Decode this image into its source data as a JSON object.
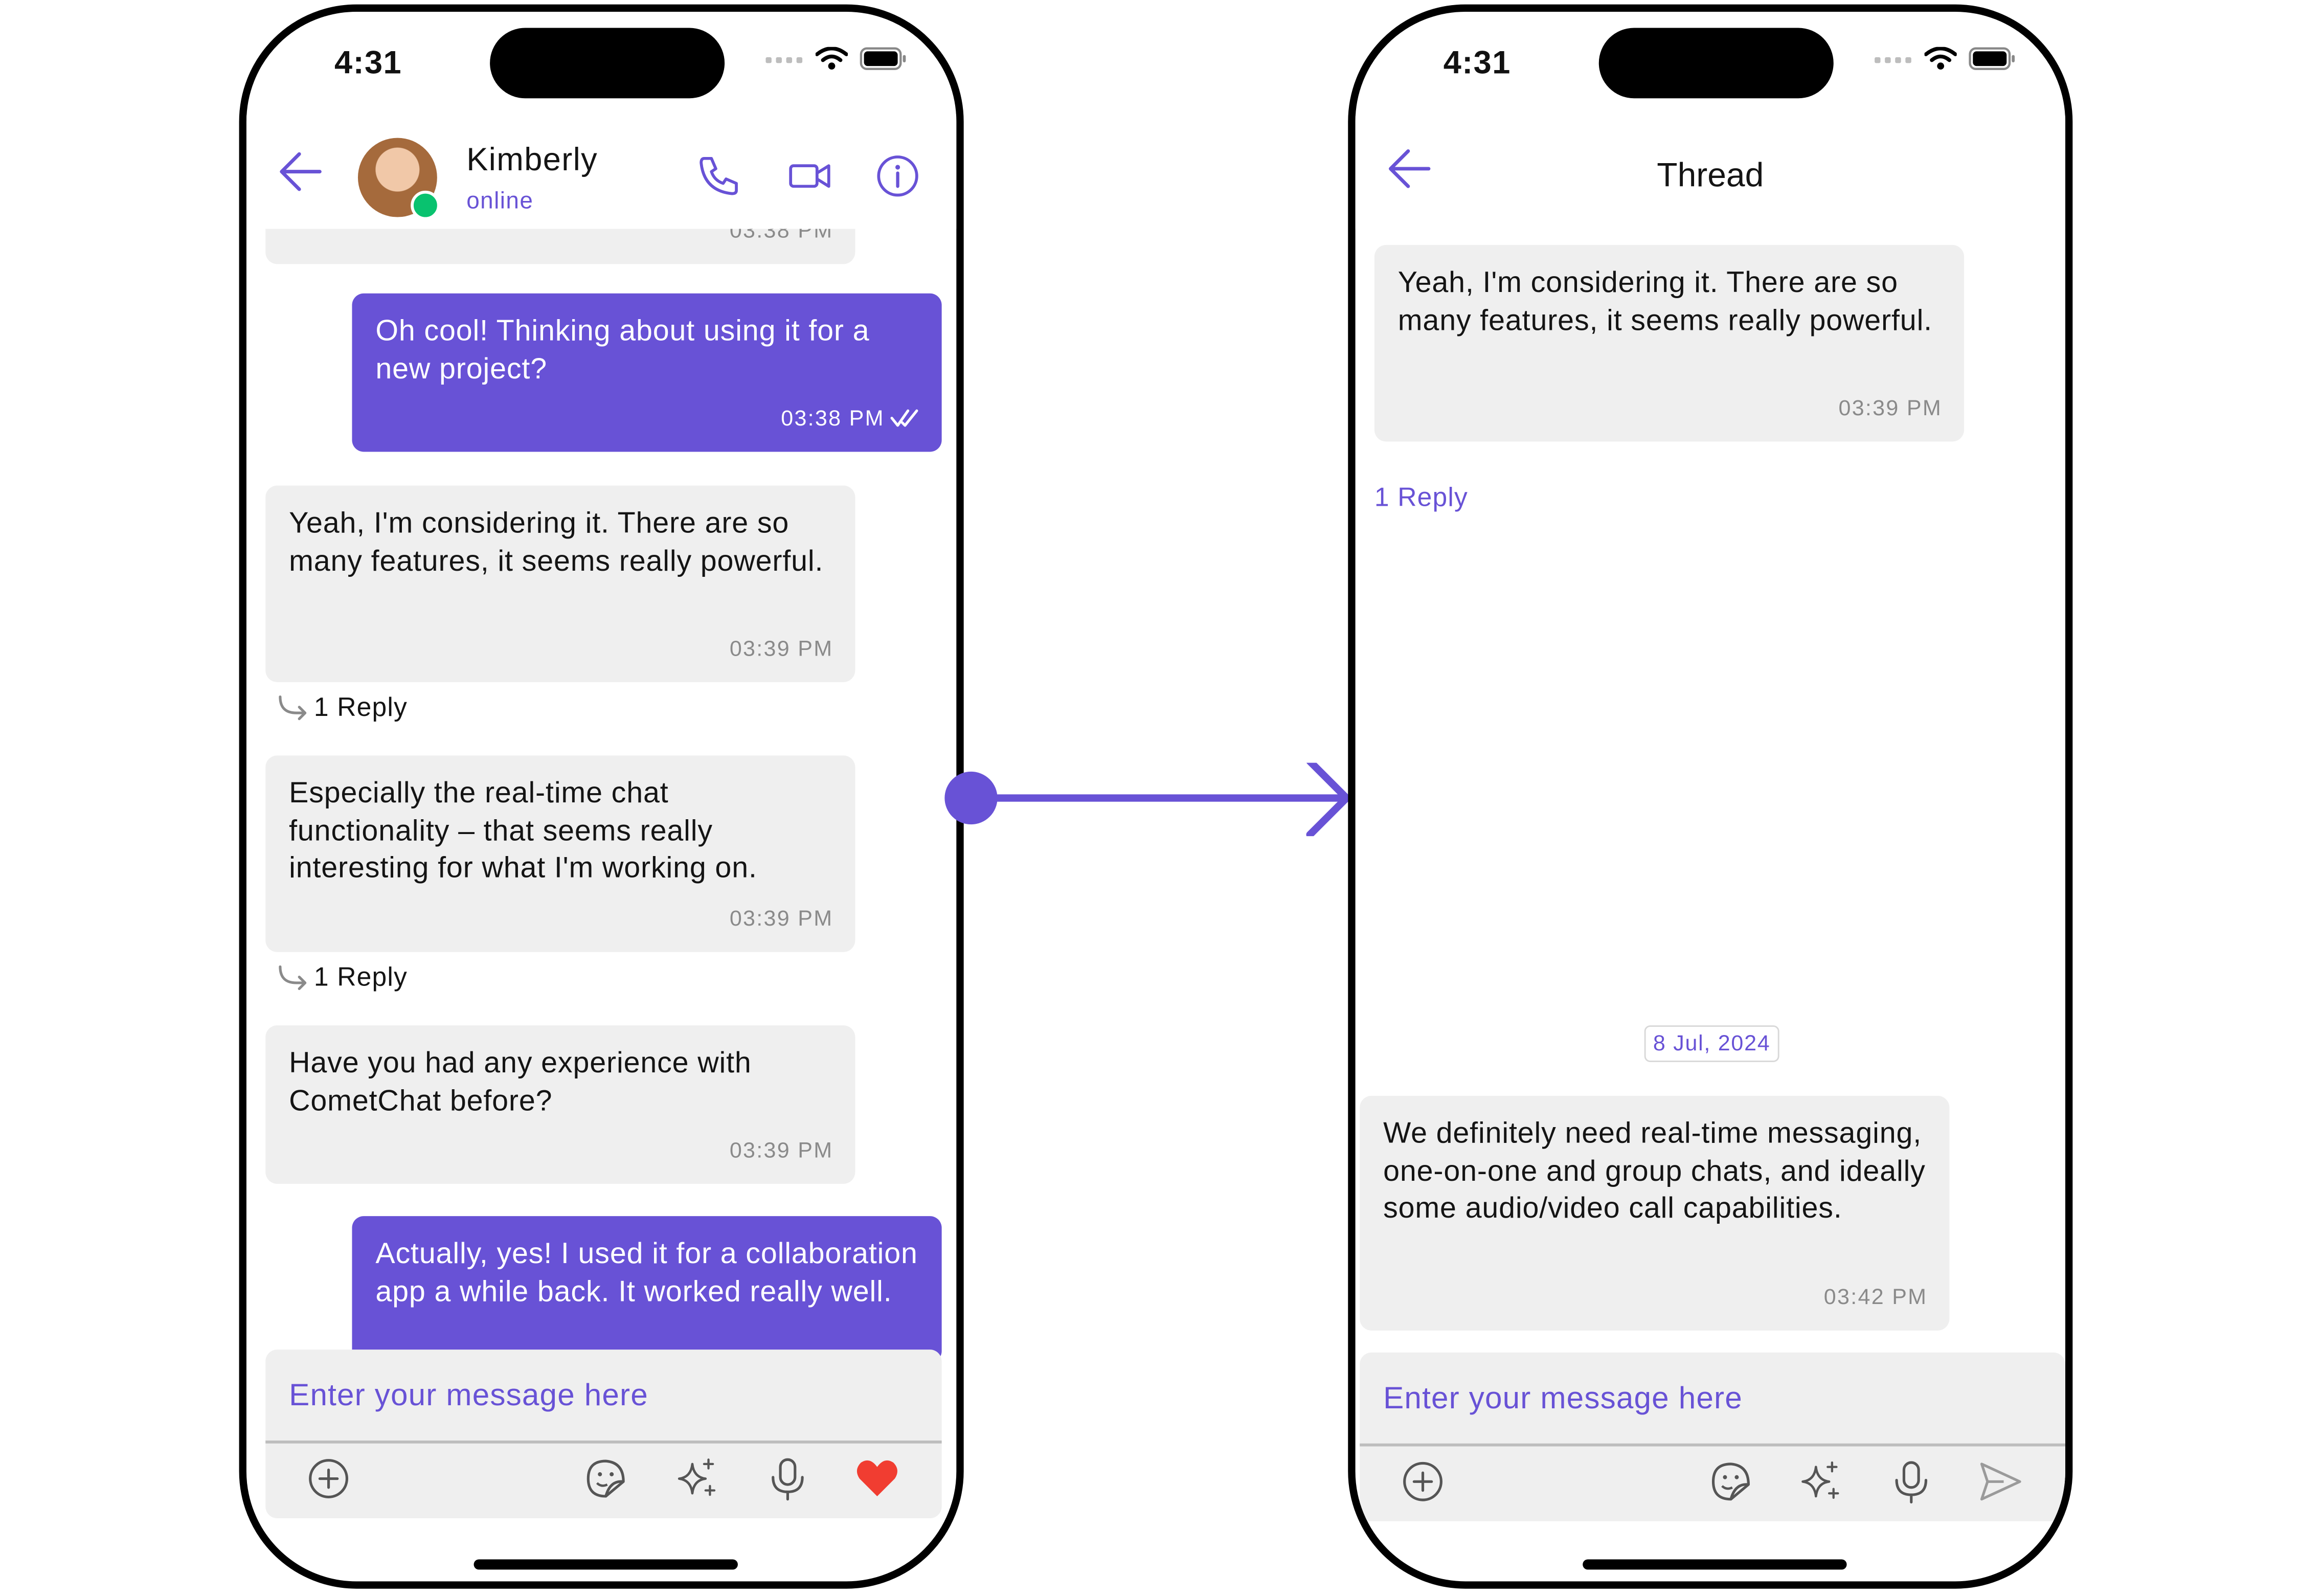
{
  "colors": {
    "accent": "#6852d6",
    "incoming_bubble": "#efefef",
    "online": "#09c26f",
    "heart": "#f13d31"
  },
  "status_bar": {
    "time": "4:31"
  },
  "chat": {
    "header": {
      "name": "Kimberly",
      "status": "online"
    },
    "partial_timestamp": "03:38 PM",
    "messages": [
      {
        "text": "Oh cool! Thinking about using it for a new project?",
        "time": "03:38 PM"
      },
      {
        "text": "Yeah, I'm considering it.  There are so many features, it seems really powerful.",
        "time": "03:39 PM",
        "replies": "1 Reply"
      },
      {
        "text": "Especially the real-time chat functionality – that seems really interesting for what I'm working on.",
        "time": "03:39 PM",
        "replies": "1 Reply"
      },
      {
        "text": "Have you had any experience with CometChat before?",
        "time": "03:39 PM"
      },
      {
        "text": "Actually, yes!  I used it for a collaboration app a while back.  It worked really well."
      }
    ],
    "composer": {
      "placeholder": "Enter your message here"
    }
  },
  "thread": {
    "title": "Thread",
    "parent": {
      "text": "Yeah, I'm considering it.  There are so many features, it seems really powerful.",
      "time": "03:39 PM"
    },
    "reply_count": "1 Reply",
    "date_separator": "8 Jul, 2024",
    "reply": {
      "text": "We definitely need real-time messaging, one-on-one and group chats, and ideally some audio/video call capabilities.",
      "time": "03:42 PM"
    },
    "composer": {
      "placeholder": "Enter your message here"
    }
  },
  "icons": {
    "back": "back-arrow-icon",
    "call": "phone-icon",
    "video": "video-camera-icon",
    "info": "info-icon",
    "reply_arrow": "reply-arrow-icon",
    "read_receipt": "double-check-icon",
    "attach": "plus-circle-icon",
    "sticker": "sticker-icon",
    "ai": "sparkle-icon",
    "mic": "microphone-icon",
    "reaction": "heart-icon",
    "send": "send-icon"
  }
}
